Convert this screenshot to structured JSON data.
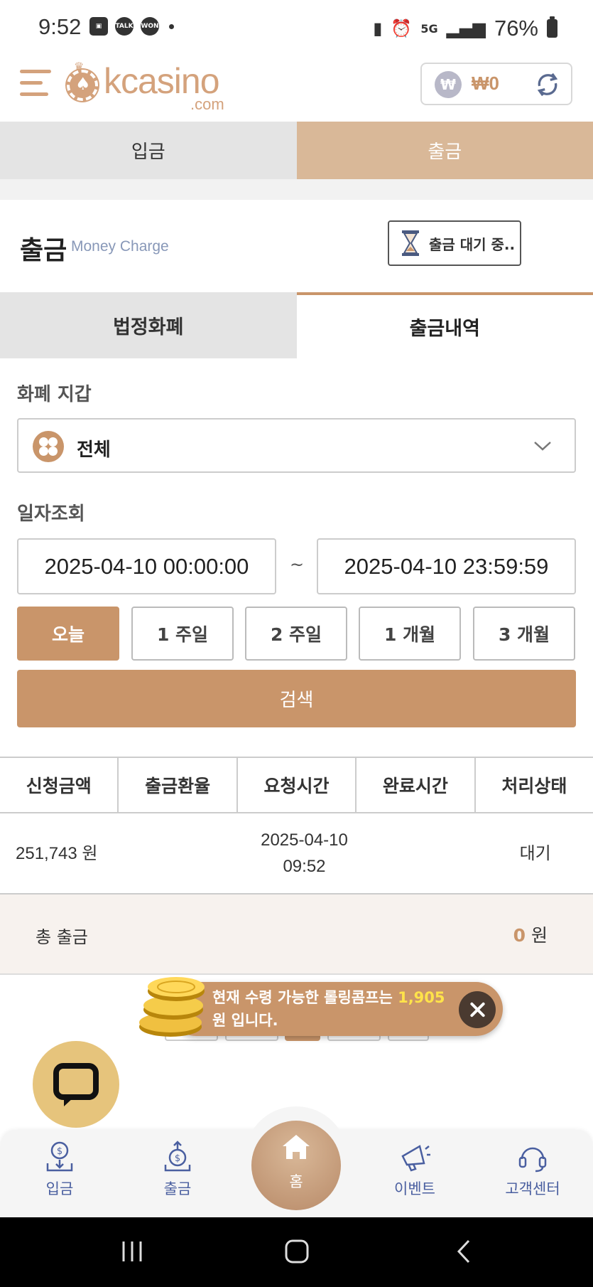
{
  "status_bar": {
    "time": "9:52",
    "battery": "76%",
    "talk_badge": "TALK",
    "won_badge": "WON"
  },
  "header": {
    "logo_text": "kcasino",
    "logo_sub": ".com",
    "balance": "₩0",
    "won_symbol": "₩"
  },
  "top_tabs": [
    {
      "label": "입금",
      "active": false
    },
    {
      "label": "출금",
      "active": true
    }
  ],
  "title": {
    "main": "출금",
    "sub": "Money Charge",
    "pending_button": "출금 대기 중.."
  },
  "sub_tabs": [
    {
      "label": "법정화폐",
      "active": false
    },
    {
      "label": "출금내역",
      "active": true
    }
  ],
  "wallet": {
    "label": "화폐 지갑",
    "selected": "전체"
  },
  "date_search": {
    "label": "일자조회",
    "start": "2025-04-10 00:00:00",
    "end": "2025-04-10 23:59:59",
    "separator": "~",
    "ranges": [
      "오늘",
      "1 주일",
      "2 주일",
      "1 개월",
      "3 개월"
    ],
    "selected_range": "오늘",
    "search_button": "검색"
  },
  "table": {
    "headers": [
      "신청금액",
      "출금환율",
      "요청시간",
      "완료시간",
      "처리상태"
    ],
    "rows": [
      {
        "amount": "251,743 원",
        "rate": "",
        "request_date": "2025-04-10",
        "request_time": "09:52",
        "complete_time": "",
        "status": "대기"
      }
    ],
    "total_label": "총 출금",
    "total_value": "0",
    "total_unit": "원"
  },
  "toast": {
    "text_before": "현재 수령 가능한 롤링콤프는 ",
    "amount": "1,905",
    "text_after": " 원 입니다."
  },
  "bottom_nav": {
    "items": [
      "입금",
      "출금",
      "홈",
      "이벤트",
      "고객센터"
    ]
  },
  "colors": {
    "accent": "#c9956a",
    "tab_active": "#d9b898",
    "nav_label": "#4a5fa0",
    "highlight": "#ffe34a"
  }
}
